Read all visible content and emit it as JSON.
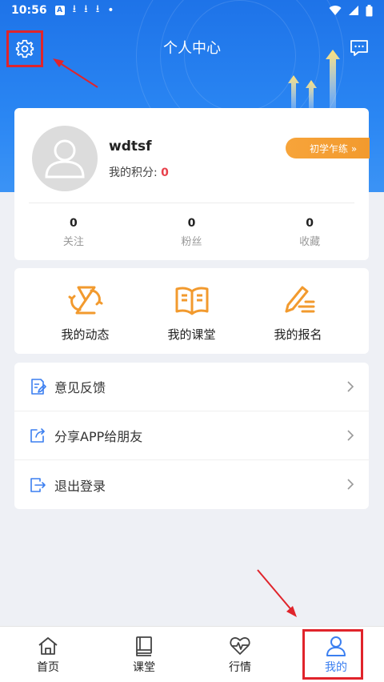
{
  "status_bar": {
    "time": "10:56"
  },
  "header": {
    "title": "个人中心"
  },
  "profile": {
    "username": "wdtsf",
    "points_label": "我的积分: ",
    "points_value": "0",
    "level_badge": "初学乍练 »"
  },
  "stats": [
    {
      "value": "0",
      "label": "关注"
    },
    {
      "value": "0",
      "label": "粉丝"
    },
    {
      "value": "0",
      "label": "收藏"
    }
  ],
  "actions": [
    {
      "label": "我的动态",
      "icon": "dynamics-icon"
    },
    {
      "label": "我的课堂",
      "icon": "book-icon"
    },
    {
      "label": "我的报名",
      "icon": "signup-pen-icon"
    }
  ],
  "menu": [
    {
      "label": "意见反馈",
      "icon": "feedback-icon"
    },
    {
      "label": "分享APP给朋友",
      "icon": "share-icon"
    },
    {
      "label": "退出登录",
      "icon": "logout-icon"
    }
  ],
  "nav": [
    {
      "label": "首页",
      "icon": "home-icon"
    },
    {
      "label": "课堂",
      "icon": "classroom-book-icon"
    },
    {
      "label": "行情",
      "icon": "market-heartbeat-icon"
    },
    {
      "label": "我的",
      "icon": "user-icon",
      "active": true
    }
  ],
  "colors": {
    "header_blue": "#1e73e8",
    "accent_orange": "#f29a2e",
    "menu_icon_blue": "#3b7ff0",
    "points_red": "#e8414b",
    "annotation_red": "#e0242b"
  }
}
